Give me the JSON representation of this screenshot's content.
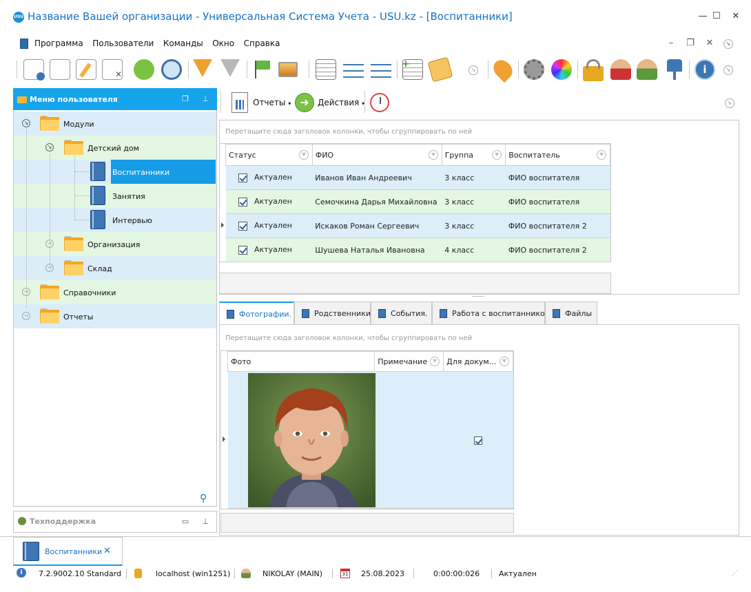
{
  "window": {
    "title": "Название Вашей организации - Универсальная Система Учета - USU.kz - [Воспитанники]",
    "logo_text": "USU"
  },
  "menu": {
    "items": [
      "Программа",
      "Пользователи",
      "Команды",
      "Окно",
      "Справка"
    ]
  },
  "toolbar": {
    "icons": [
      "new-record-icon",
      "copy-icon",
      "edit-icon",
      "delete-icon",
      "refresh-icon",
      "search-icon",
      "filter-icon",
      "filter-check-icon",
      "flag-icon",
      "image-icon",
      "columns-icon",
      "expand-tree-icon",
      "collapse-tree-icon",
      "add-row-icon",
      "notes-icon",
      "location-icon",
      "settings-icon",
      "color-icon",
      "lock-icon",
      "user-icon",
      "users-icon",
      "plugin-icon",
      "info-icon"
    ]
  },
  "left_panel": {
    "title": "Меню пользователя",
    "tree": [
      {
        "label": "Модули",
        "level": 0,
        "type": "folder",
        "state": "expanded"
      },
      {
        "label": "Детский дом",
        "level": 1,
        "type": "folder",
        "state": "expanded"
      },
      {
        "label": "Воспитанники",
        "level": 2,
        "type": "book",
        "selected": true
      },
      {
        "label": "Занятия",
        "level": 2,
        "type": "book"
      },
      {
        "label": "Интервью",
        "level": 2,
        "type": "book"
      },
      {
        "label": "Организация",
        "level": 1,
        "type": "folder",
        "state": "collapsed"
      },
      {
        "label": "Склад",
        "level": 1,
        "type": "folder",
        "state": "collapsed"
      },
      {
        "label": "Справочники",
        "level": 0,
        "type": "folder",
        "state": "collapsed"
      },
      {
        "label": "Отчеты",
        "level": 0,
        "type": "folder",
        "state": "collapsed"
      }
    ]
  },
  "support_panel": {
    "title": "Техподдержка"
  },
  "actions_bar": {
    "reports_label": "Отчеты",
    "actions_label": "Действия",
    "dropdown_glyph": "▾"
  },
  "main_grid": {
    "group_hint": "Перетащите сюда заголовок колонки, чтобы сгруппировать по ней",
    "columns": [
      "Статус",
      "ФИО",
      "Группа",
      "Воспитатель"
    ],
    "rows": [
      {
        "checked": true,
        "status": "Актуален",
        "fio": "Иванов Иван Андреевич",
        "group": "3 класс",
        "teacher": "ФИО воспитателя",
        "current": false
      },
      {
        "checked": true,
        "status": "Актуален",
        "fio": "Семочкина Дарья Михайловна",
        "group": "3 класс",
        "teacher": "ФИО воспитателя",
        "current": false
      },
      {
        "checked": true,
        "status": "Актуален",
        "fio": "Искаков Роман Сергеевич",
        "group": "3 класс",
        "teacher": "ФИО воспитателя 2",
        "current": true
      },
      {
        "checked": true,
        "status": "Актуален",
        "fio": "Шушева Наталья Ивановна",
        "group": "4 класс",
        "teacher": "ФИО воспитателя 2",
        "current": false
      }
    ]
  },
  "detail_tabs": {
    "tabs": [
      "Фотографии.",
      "Родственники",
      "События.",
      "Работа с воспитанником",
      "Файлы"
    ],
    "active": 0
  },
  "detail_grid": {
    "group_hint": "Перетащите сюда заголовок колонки, чтобы сгруппировать по ней",
    "columns": [
      "Фото",
      "Примечание",
      "Для докум..."
    ],
    "rows": [
      {
        "photo": "portrait-of-boy",
        "note": "",
        "for_docs": true
      }
    ]
  },
  "open_tabs": {
    "items": [
      {
        "label": "Воспитанники",
        "close": "✕"
      }
    ]
  },
  "status_bar": {
    "version": "7.2.9002.10 Standard",
    "server": "localhost (win1251)",
    "user": "NIKOLAY (MAIN)",
    "date": "25.08.2023",
    "timer": "0:00:00:026",
    "status": "Актуален"
  },
  "colors": {
    "accent": "#169be6",
    "row_blue": "#dbeefa",
    "row_green": "#e3f7e3",
    "title_text": "#1673c7"
  }
}
